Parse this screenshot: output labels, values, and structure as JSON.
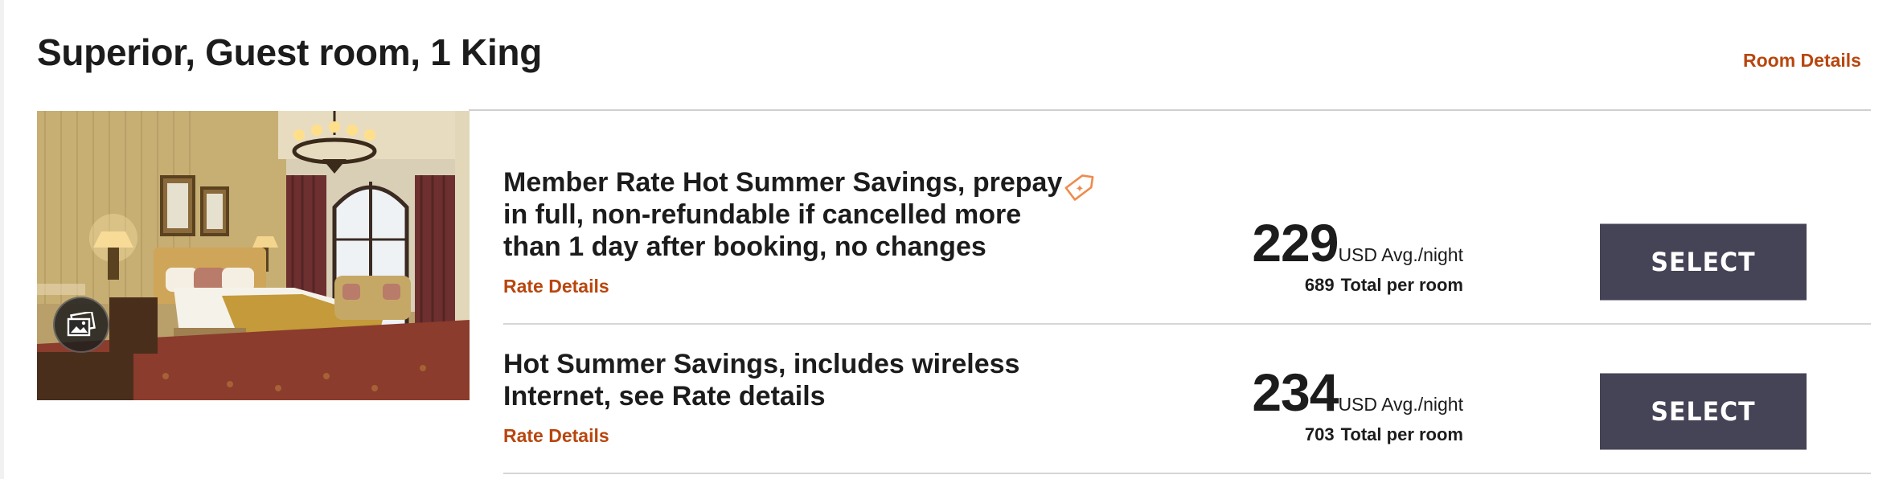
{
  "room": {
    "title": "Superior, Guest room, 1 King",
    "details_link": "Room Details"
  },
  "rates": [
    {
      "title": "Member Rate Hot Summer Savings, prepay in full, non-refundable if cancelled more than 1 day after booking, no changes",
      "details_link": "Rate Details",
      "price": "229",
      "price_unit": "USD Avg./night",
      "total": "689",
      "total_label": "Total per room",
      "select_label": "SELECT",
      "has_member_tag": true
    },
    {
      "title": "Hot Summer Savings, includes wireless Internet, see Rate details",
      "details_link": "Rate Details",
      "price": "234",
      "price_unit": "USD Avg./night",
      "total": "703",
      "total_label": "Total per room",
      "select_label": "SELECT",
      "has_member_tag": false
    }
  ],
  "icons": {
    "gallery": "image-gallery-icon",
    "tag": "member-rate-tag-icon"
  },
  "colors": {
    "link": "#b8460e",
    "button": "#454356",
    "tag": "#f08a4b"
  }
}
